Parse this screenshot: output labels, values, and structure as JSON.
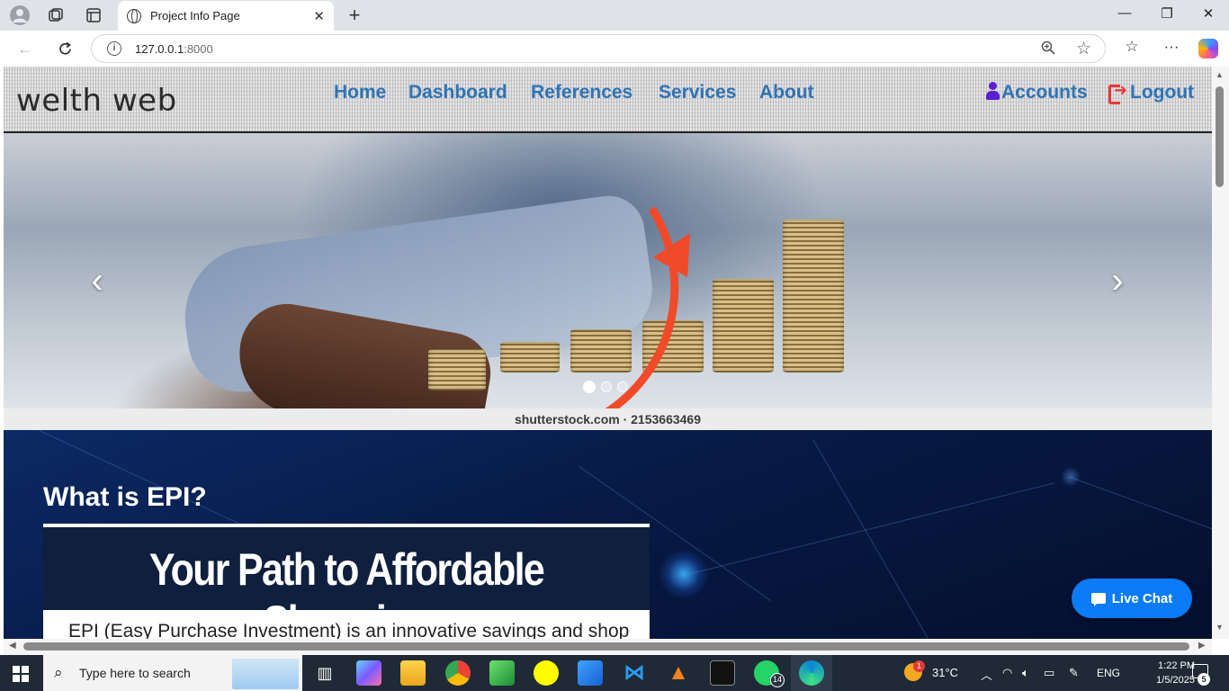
{
  "browser": {
    "tab_title": "Project Info Page",
    "url_host": "127.0.0.1",
    "url_port": ":8000",
    "close_glyph": "✕",
    "new_tab_glyph": "+"
  },
  "site": {
    "logo": "welth web",
    "nav": [
      {
        "label": "Home"
      },
      {
        "label": "Dashboard"
      },
      {
        "label": "References"
      },
      {
        "label": "Services"
      },
      {
        "label": "About"
      }
    ],
    "accounts_label": "Accounts",
    "logout_label": "Logout",
    "colors": {
      "nav_link": "#2e73b5",
      "accounts_icon": "#5a1fd0",
      "logout_icon": "#e53935",
      "live_chat": "#0b7bf6"
    }
  },
  "carousel": {
    "watermark": "shutterstock.com · 2153663469",
    "prev_glyph": "‹",
    "next_glyph": "›",
    "slide_count": 3,
    "active_slide": 1
  },
  "epi": {
    "title": "What is EPI?",
    "banner": "Your Path to Affordable Shopping",
    "description": "EPI (Easy Purchase Investment) is an innovative savings and shop"
  },
  "live_chat": {
    "label": "Live Chat"
  },
  "taskbar": {
    "search_placeholder": "Type here to search",
    "weather_temp": "31°C",
    "weather_badge": "1",
    "whatsapp_badge": "14",
    "language": "ENG",
    "time": "1:22 PM",
    "date": "1/5/2025",
    "notification_count": "5"
  }
}
